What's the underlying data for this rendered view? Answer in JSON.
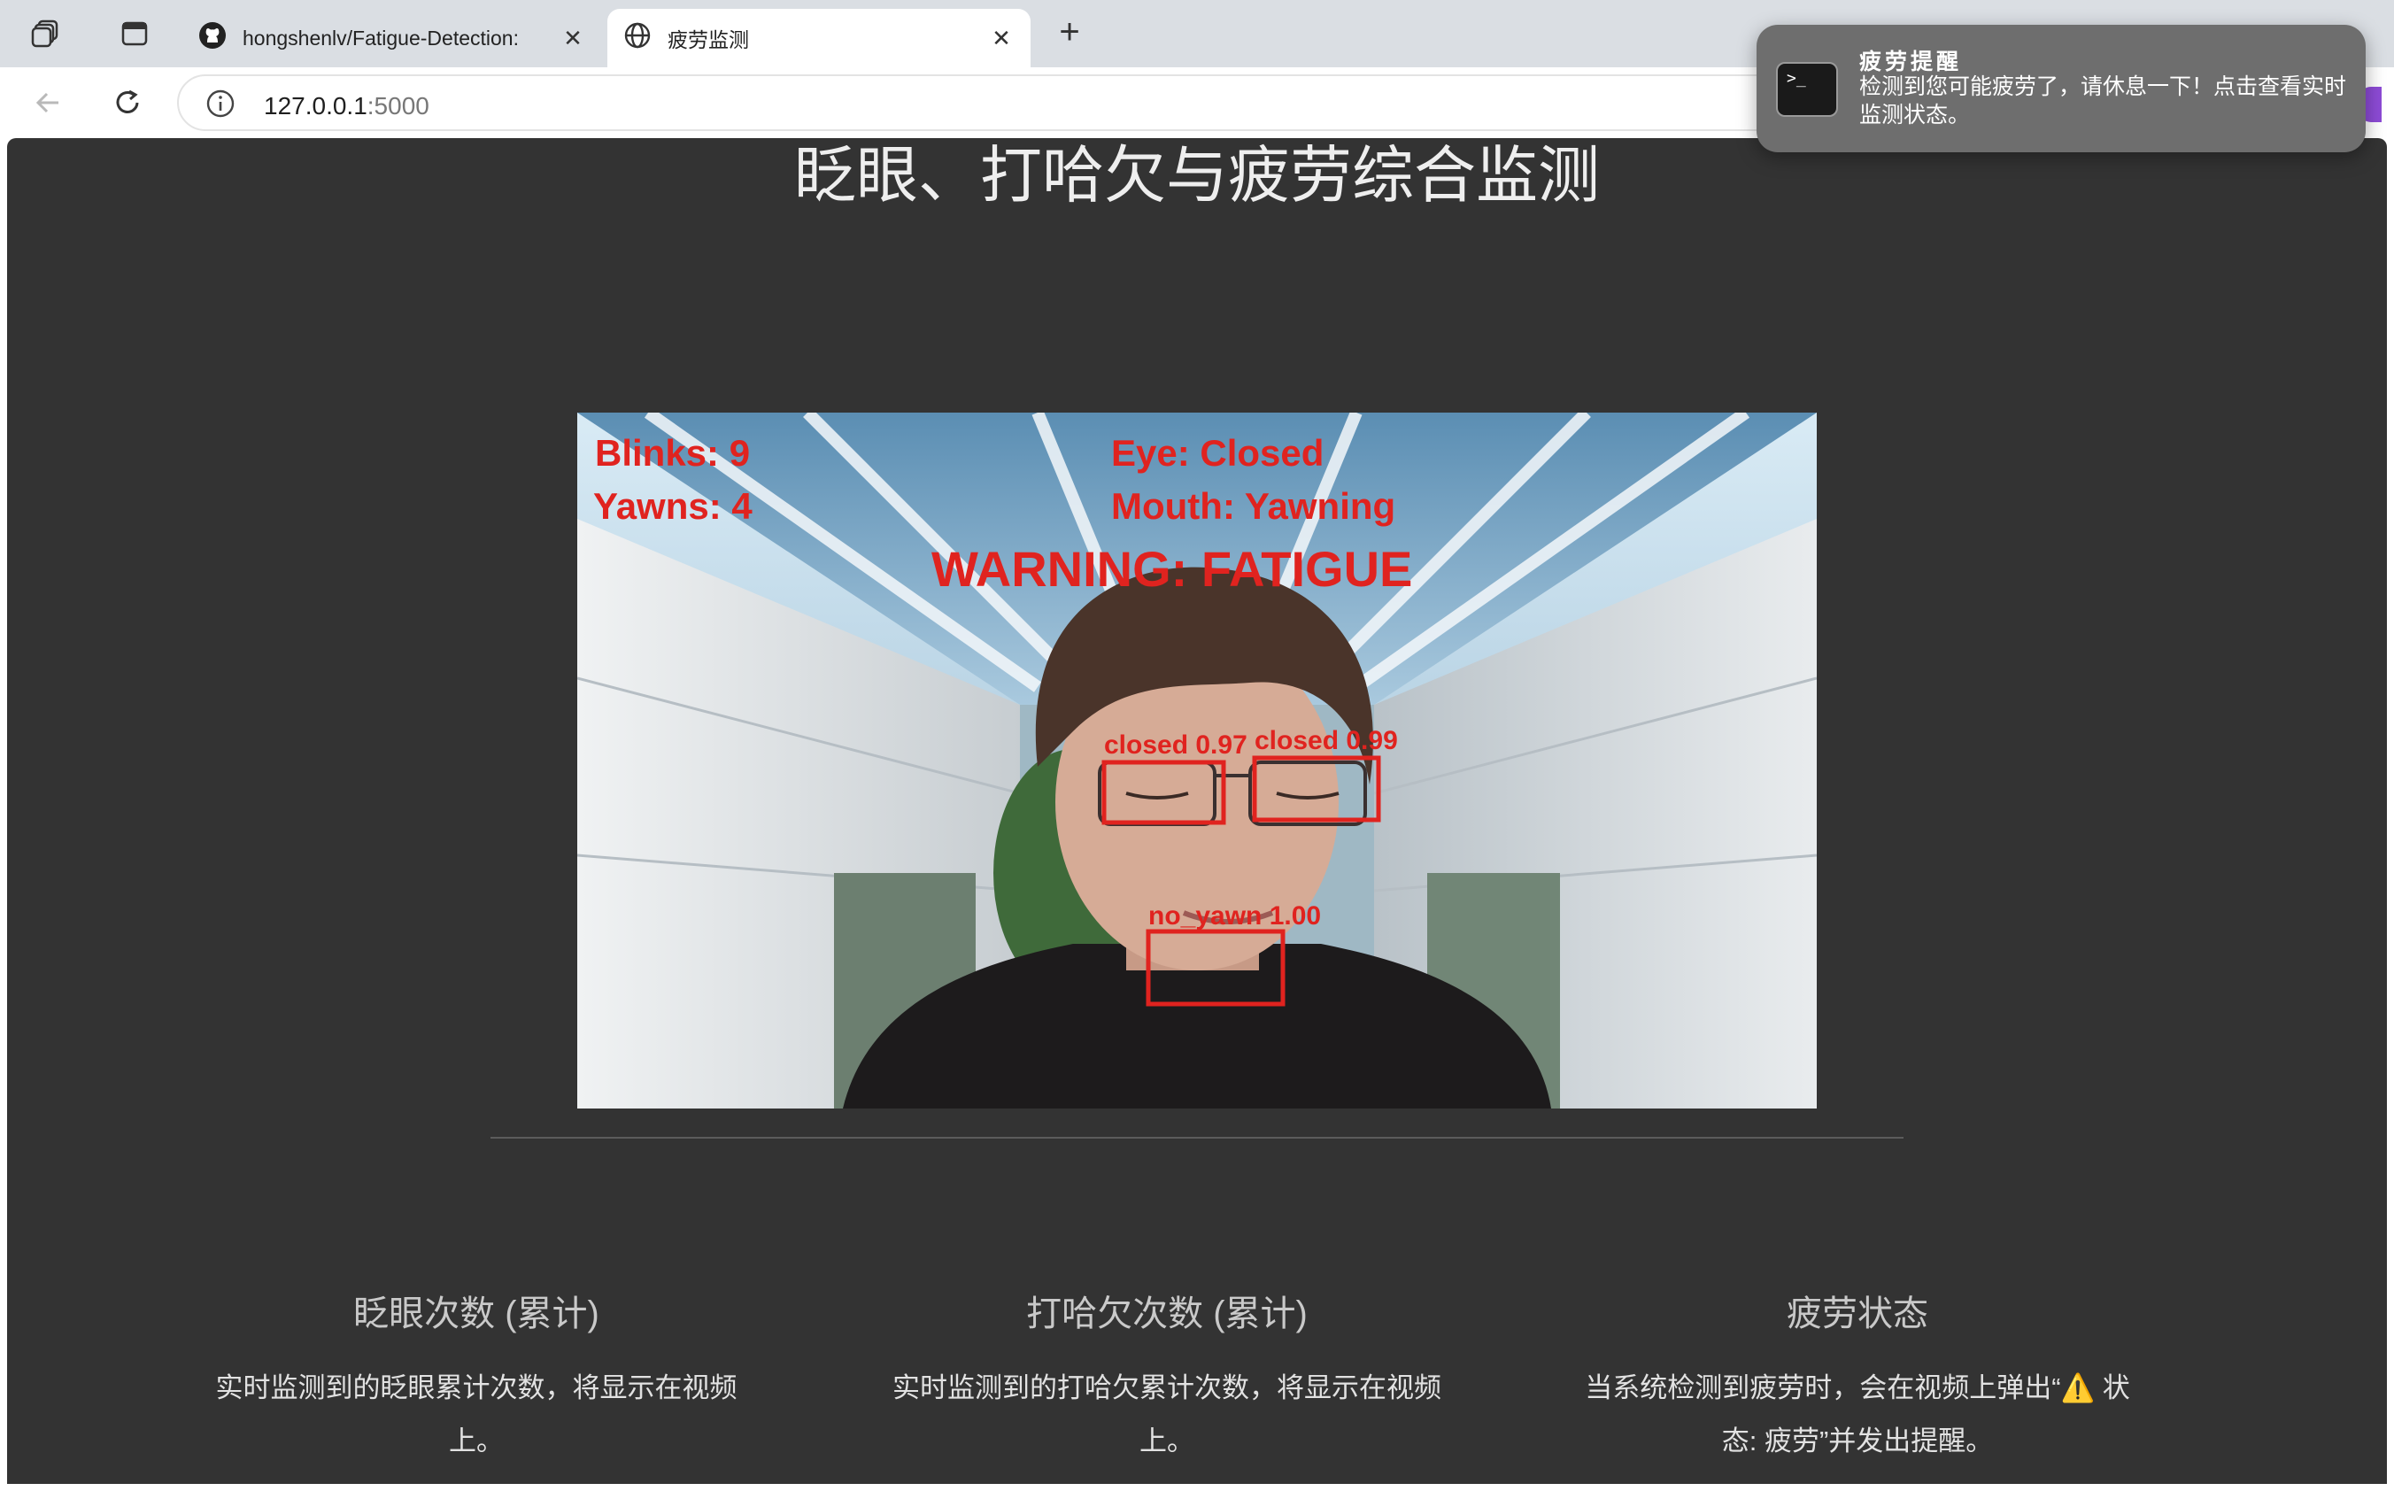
{
  "browser": {
    "tabs": [
      {
        "title": "hongshenlv/Fatigue-Detection:",
        "active": false,
        "icon": "github-icon"
      },
      {
        "title": "疲劳监测",
        "active": true,
        "icon": "globe-icon"
      }
    ],
    "address": {
      "host": "127.0.0.1",
      "port": ":5000"
    }
  },
  "notification": {
    "title": "疲劳提醒",
    "body": "检测到您可能疲劳了，请休息一下！点击查看实时监测状态。",
    "icon": "terminal-icon"
  },
  "page": {
    "title": "眨眼、打哈欠与疲劳综合监测",
    "video_overlay": {
      "blinks": "Blinks: 9",
      "yawns": "Yawns: 4",
      "eye": "Eye: Closed",
      "mouth": "Mouth: Yawning",
      "warning": "WARNING: FATIGUE",
      "left_eye_label": "closed 0.97",
      "right_eye_label": "closed 0.99",
      "mouth_label": "no_yawn 1.00"
    },
    "cards": [
      {
        "title": "眨眼次数 (累计)",
        "text": "实时监测到的眨眼累计次数，将显示在视频上。"
      },
      {
        "title": "打哈欠次数 (累计)",
        "text": "实时监测到的打哈欠累计次数，将显示在视频上。"
      },
      {
        "title": "疲劳状态",
        "text": "当系统检测到疲劳时，会在视频上弹出“⚠️ 状态: 疲劳”并发出提醒。"
      }
    ]
  },
  "colors": {
    "page_bg": "#333333",
    "overlay_red": "#e0231f",
    "tabbar_bg": "#dadee3"
  }
}
